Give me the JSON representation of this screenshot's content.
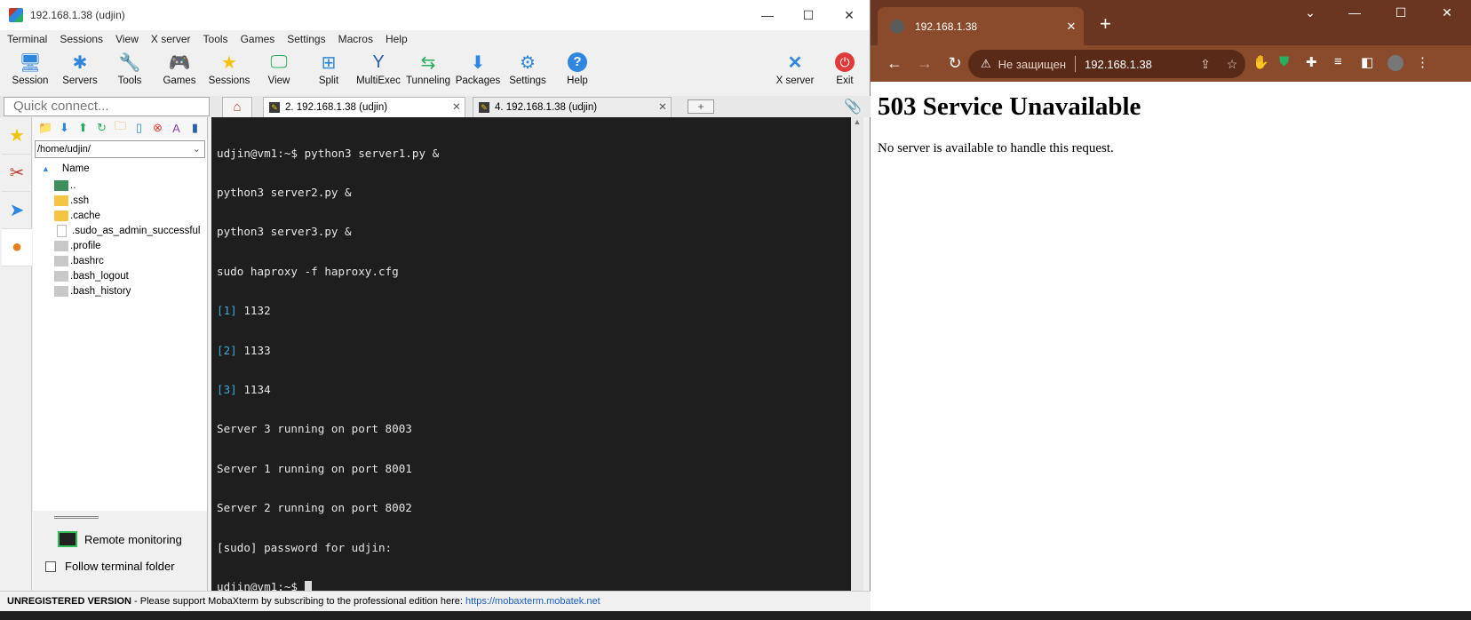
{
  "moba": {
    "title": "192.168.1.38 (udjin)",
    "window_controls": [
      "—",
      "☐",
      "✕"
    ],
    "menu": [
      "Terminal",
      "Sessions",
      "View",
      "X server",
      "Tools",
      "Games",
      "Settings",
      "Macros",
      "Help"
    ],
    "toolbar": {
      "session": "Session",
      "servers": "Servers",
      "tools": "Tools",
      "games": "Games",
      "sessions": "Sessions",
      "view": "View",
      "split": "Split",
      "multiexec": "MultiExec",
      "tunneling": "Tunneling",
      "packages": "Packages",
      "settings": "Settings",
      "help": "Help",
      "xserver": "X server",
      "exit": "Exit"
    },
    "quick_connect_placeholder": "Quick connect...",
    "tabs": [
      {
        "label": "2. 192.168.1.38 (udjin)",
        "close": "✕"
      },
      {
        "label": "4. 192.168.1.38 (udjin)",
        "close": "✕"
      }
    ],
    "sftp": {
      "path": "/home/udjin/",
      "column_name": "Name",
      "files": [
        "..",
        ".ssh",
        ".cache",
        ".sudo_as_admin_successful",
        ".profile",
        ".bashrc",
        ".bash_logout",
        ".bash_history"
      ]
    },
    "remote_monitoring": "Remote monitoring",
    "follow_terminal_folder": "Follow terminal folder",
    "terminal": {
      "lines": [
        "udjin@vm1:~$ python3 server1.py &",
        "python3 server2.py &",
        "python3 server3.py &",
        "sudo haproxy -f haproxy.cfg"
      ],
      "jobs": [
        {
          "id": "[1]",
          "pid": " 1132"
        },
        {
          "id": "[2]",
          "pid": " 1133"
        },
        {
          "id": "[3]",
          "pid": " 1134"
        }
      ],
      "output": [
        "Server 3 running on port 8003",
        "Server 1 running on port 8001",
        "Server 2 running on port 8002",
        "[sudo] password for udjin:"
      ],
      "prompt": "udjin@vm1:~$ "
    },
    "status": {
      "unregistered": "UNREGISTERED VERSION",
      "message": " -  Please support MobaXterm by subscribing to the professional edition here:  ",
      "link": "https://mobaxterm.mobatek.net"
    }
  },
  "chrome": {
    "tab_title": "192.168.1.38",
    "tab_close": "✕",
    "new_tab": "+",
    "not_secure": "Не защищен",
    "url": "192.168.1.38",
    "page_heading": "503 Service Unavailable",
    "page_text": "No server is available to handle this request."
  },
  "colors": {
    "terminal_bg": "#1e1e1e",
    "terminal_cyan": "#3fa9d4",
    "chrome_frame": "#8a4a2c"
  }
}
